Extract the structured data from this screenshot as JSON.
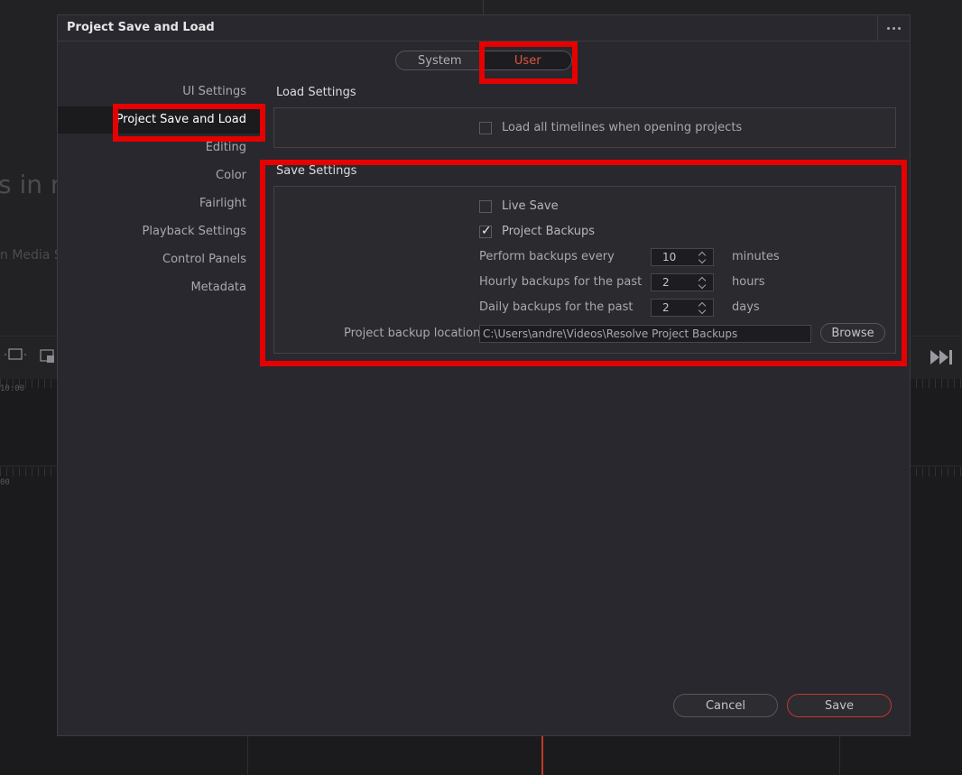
{
  "background": {
    "viewer_text": "s in n",
    "viewer_subtext": "n Media S",
    "timecode_1": "10:00",
    "timecode_2": "00"
  },
  "dialog": {
    "title": "Project Save and Load",
    "more_icon": "more-horizontal-icon",
    "tabs": [
      {
        "label": "System",
        "active": false
      },
      {
        "label": "User",
        "active": true
      }
    ],
    "accent_color": "#e0553a"
  },
  "sidebar": {
    "items": [
      {
        "label": "UI Settings",
        "selected": false
      },
      {
        "label": "Project Save and Load",
        "selected": true
      },
      {
        "label": "Editing",
        "selected": false
      },
      {
        "label": "Color",
        "selected": false
      },
      {
        "label": "Fairlight",
        "selected": false
      },
      {
        "label": "Playback Settings",
        "selected": false
      },
      {
        "label": "Control Panels",
        "selected": false
      },
      {
        "label": "Metadata",
        "selected": false
      }
    ]
  },
  "load_settings": {
    "title": "Load Settings",
    "load_all_timelines": {
      "label": "Load all timelines when opening projects",
      "checked": false
    }
  },
  "save_settings": {
    "title": "Save Settings",
    "live_save": {
      "label": "Live Save",
      "checked": false
    },
    "project_backups": {
      "label": "Project Backups",
      "checked": true
    },
    "perform_backups": {
      "label": "Perform backups every",
      "value": "10",
      "unit": "minutes"
    },
    "hourly_backups": {
      "label": "Hourly backups for the past",
      "value": "2",
      "unit": "hours"
    },
    "daily_backups": {
      "label": "Daily backups for the past",
      "value": "2",
      "unit": "days"
    },
    "backup_location": {
      "label": "Project backup location",
      "value": "C:\\Users\\andre\\Videos\\Resolve Project Backups",
      "browse_label": "Browse"
    }
  },
  "footer": {
    "cancel_label": "Cancel",
    "save_label": "Save"
  },
  "highlight_color": "#e60000"
}
